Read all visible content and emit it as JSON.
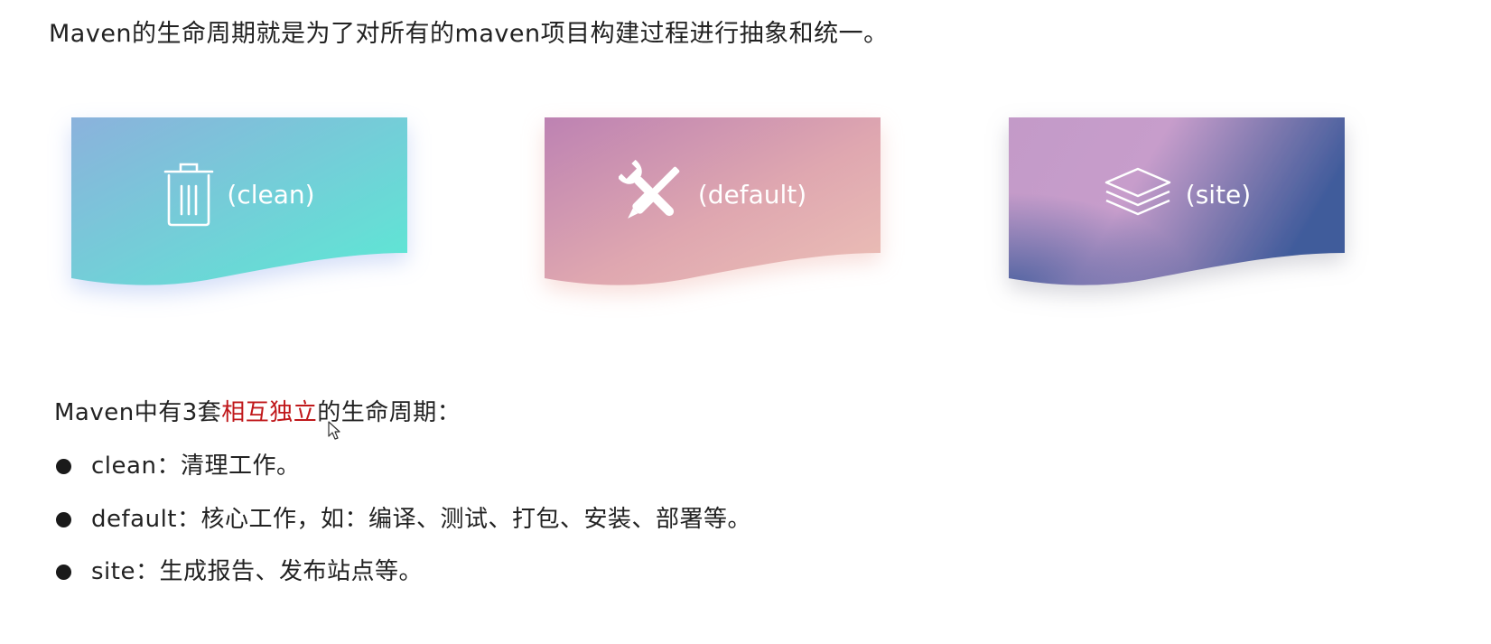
{
  "intro_text": "Maven的生命周期就是为了对所有的maven项目构建过程进行抽象和统一。",
  "cards": [
    {
      "label": "(clean)",
      "icon": "trash-icon",
      "colors": [
        "#8bb2dc",
        "#5ce9d4"
      ]
    },
    {
      "label": "(default)",
      "icon": "tools-icon",
      "colors": [
        "#bd82b2",
        "#ecc0b6"
      ]
    },
    {
      "label": "(site)",
      "icon": "layers-icon",
      "colors": [
        "#c39ac8",
        "#3f5b9b"
      ]
    }
  ],
  "heading": {
    "prefix": "Maven中有3套",
    "emphasis": "相互独立",
    "suffix": "的生命周期：",
    "emphasis_color": "#c0181b"
  },
  "bullets": [
    {
      "term": "clean",
      "sep": "：",
      "desc": "清理工作。"
    },
    {
      "term": "default",
      "sep": "：",
      "desc": "核心工作，如：编译、测试、打包、安装、部署等。"
    },
    {
      "term": "site",
      "sep": "：",
      "desc": "生成报告、发布站点等。"
    }
  ]
}
